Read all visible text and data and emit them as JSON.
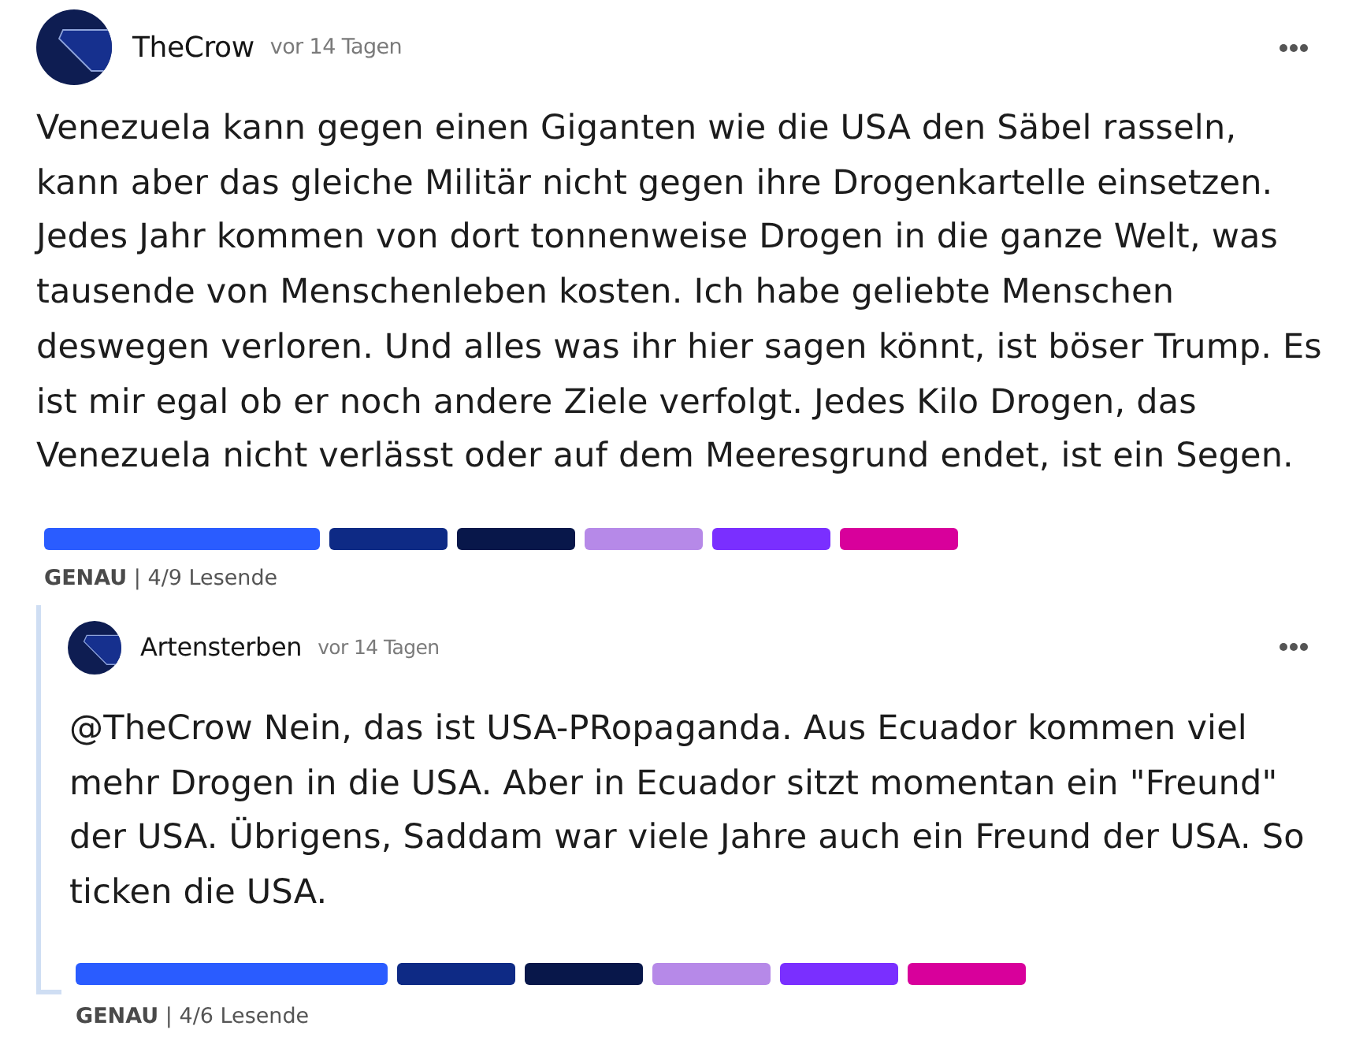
{
  "comment": {
    "author": "TheCrow",
    "time": "vor 14 Tagen",
    "body": "Venezuela kann gegen einen Giganten wie die USA den Säbel rasseln, kann aber das gleiche Militär nicht gegen ihre Drogenkartelle einsetzen. Jedes Jahr kommen von dort tonnenweise Drogen in die ganze Welt, was tausende von Menschenleben kosten. Ich habe geliebte Menschen deswegen verloren. Und alles was ihr hier sagen könnt, ist böser Trump. Es ist mir egal ob er noch andere Ziele verfolgt. Jedes Kilo Drogen, das Venezuela nicht verlässt oder auf dem Meeresgrund endet, ist ein Segen.",
    "ratings": [
      {
        "color": "#2a5cff",
        "selected": true
      },
      {
        "color": "#0e2a85",
        "selected": false
      },
      {
        "color": "#08174a",
        "selected": false
      },
      {
        "color": "#b689e8",
        "selected": false
      },
      {
        "color": "#7a2fff",
        "selected": false
      },
      {
        "color": "#d8009b",
        "selected": false
      }
    ],
    "summary": "**GENAU** | 4/9 Lesende",
    "replies": [
      {
        "author": "Artensterben",
        "time": "vor 14 Tagen",
        "body": "@TheCrow Nein, das ist USA-PRopaganda. Aus Ecuador kommen viel mehr Drogen in die USA. Aber in Ecuador sitzt momentan ein \"Freund\" der USA. Übrigens, Saddam war viele Jahre auch ein Freund der USA. So ticken die USA.",
        "ratings": [
          {
            "color": "#2a5cff",
            "selected": true
          },
          {
            "color": "#0e2a85",
            "selected": false
          },
          {
            "color": "#08174a",
            "selected": false
          },
          {
            "color": "#b689e8",
            "selected": false
          },
          {
            "color": "#7a2fff",
            "selected": false
          },
          {
            "color": "#d8009b",
            "selected": false
          }
        ],
        "summary": "**GENAU** | 4/6 Lesende"
      }
    ]
  }
}
